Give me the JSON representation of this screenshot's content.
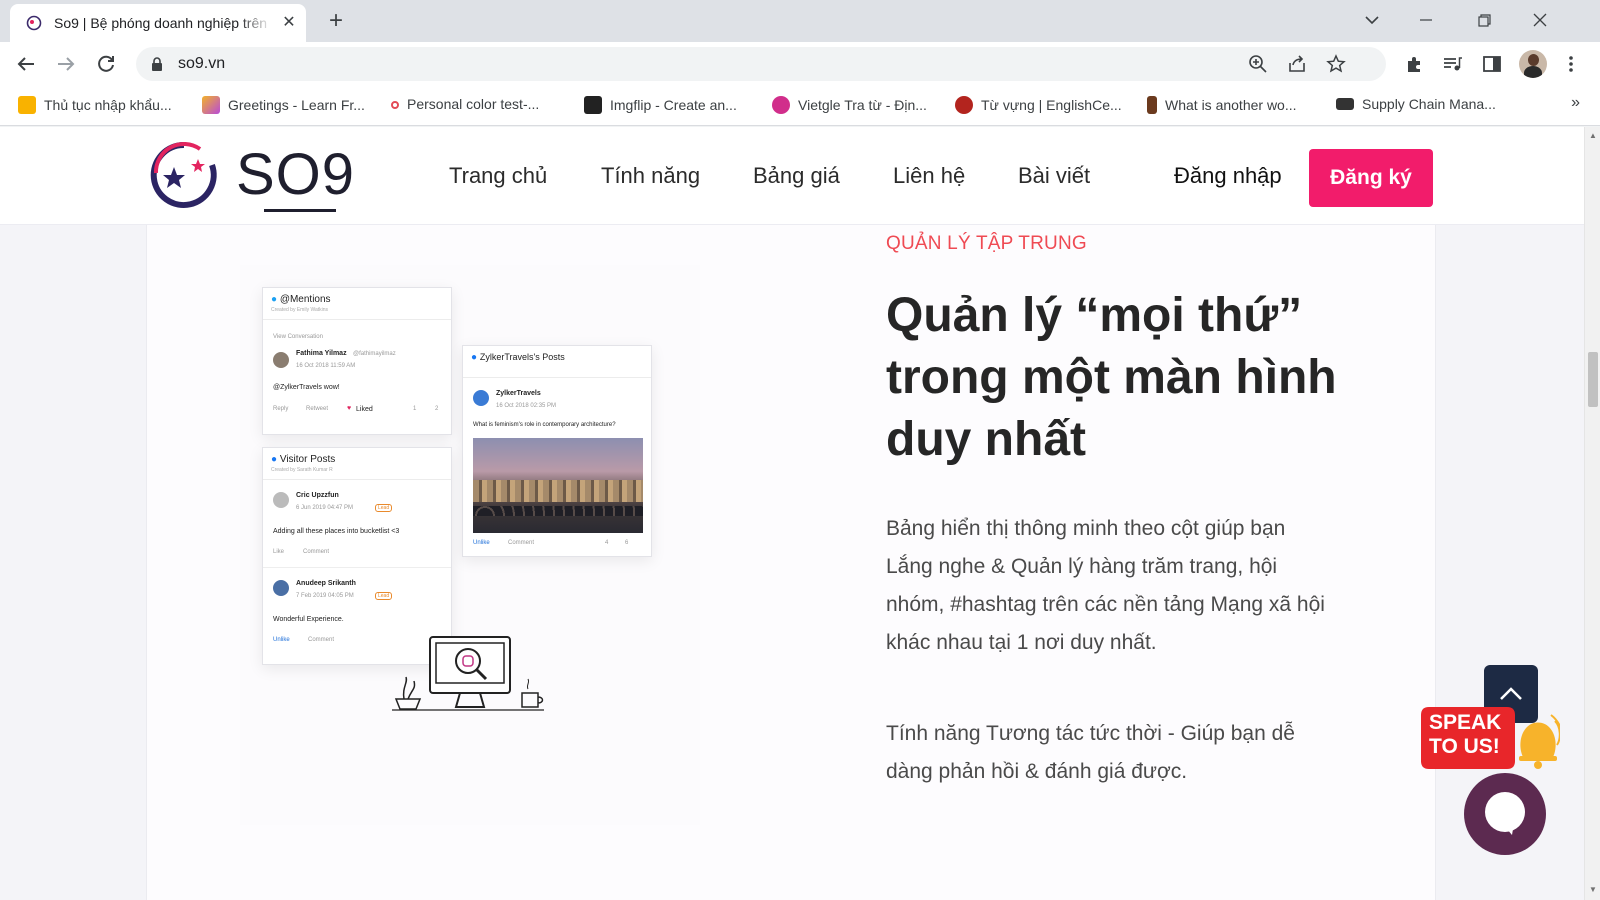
{
  "browser": {
    "tab_title": "So9 | Bệ phóng doanh nghiệp trên",
    "tab_close": "✕",
    "new_tab": "+",
    "url": "so9.vn",
    "bookmarks": [
      {
        "label": "Thủ tục nhập khẩu...",
        "icon": "bookmark-4-icon",
        "color": "#f9b200"
      },
      {
        "label": "Greetings - Learn Fr...",
        "icon": "bookmark-chart-icon",
        "color": "#b84ad8"
      },
      {
        "label": "Personal color test-...",
        "icon": "bookmark-dot-icon",
        "color": "#e34b56"
      },
      {
        "label": "Imgflip - Create an...",
        "icon": "bookmark-imgflip-icon",
        "color": "#222222"
      },
      {
        "label": "Vietgle Tra từ - Địn...",
        "icon": "bookmark-vietgle-icon",
        "color": "#d12e8b"
      },
      {
        "label": "Từ vựng | EnglishCe...",
        "icon": "bookmark-bubble-icon",
        "color": "#b3241e"
      },
      {
        "label": "What is another wo...",
        "icon": "bookmark-h-icon",
        "color": "#6b3a1e"
      },
      {
        "label": "Supply Chain Mana...",
        "icon": "bookmark-edx-icon",
        "color": "#333333"
      }
    ],
    "bookmarks_more": "»"
  },
  "site": {
    "brand": "SO9",
    "nav": [
      {
        "label": "Trang chủ"
      },
      {
        "label": "Tính năng"
      },
      {
        "label": "Bảng giá"
      },
      {
        "label": "Liên hệ"
      },
      {
        "label": "Bài viết"
      }
    ],
    "login": "Đăng nhập",
    "signup": "Đăng ký",
    "accent": "#f21c6b"
  },
  "section": {
    "eyebrow": "QUẢN LÝ TẬP TRUNG",
    "headline": "Quản lý “mọi thứ” trong một màn hình duy nhất",
    "para1": "Bảng hiển thị thông minh theo cột giúp bạn Lắng nghe & Quản lý hàng trăm trang, hội nhóm, #hashtag trên các nền tảng Mạng xã hội khác nhau tại 1 nơi duy nhất.",
    "para2": "Tính năng Tương tác tức thời - Giúp bạn dễ dàng phản hồi & đánh giá được.",
    "eyebrow_color": "#ef4a53"
  },
  "illustration": {
    "mentions": {
      "title": "@Mentions",
      "sub": "Created by Emily Watkins",
      "view": "View Conversation",
      "author": "Fathima Yilmaz",
      "handle": "@fathimayilmaz",
      "date": "16 Oct 2018 11:59 AM",
      "text_tag": "@ZylkerTravels",
      "text_rest": " wow!",
      "reply": "Reply",
      "retweet": "Retweet",
      "liked": "Liked",
      "count1": "1",
      "count2": "2"
    },
    "visitor": {
      "title": "Visitor Posts",
      "sub": "Created by Sarath Kumar R",
      "p1_author": "Cric Upzzfun",
      "p1_date": "6 Jun 2019 04:47 PM",
      "p1_text": "Adding all these places into bucketlist <3",
      "p2_author": "Anudeep Srikanth",
      "p2_date": "7 Feb 2019 04:05 PM",
      "p2_text": "Wonderful Experience.",
      "like": "Like",
      "unlike": "Unlike",
      "comment": "Comment",
      "lead": "Lead"
    },
    "zylker": {
      "title": "ZylkerTravels's Posts",
      "author": "ZylkerTravels",
      "date": "16 Oct 2018 02:35 PM",
      "text": "What is feminism's role in contemporary architecture?",
      "unlike": "Unlike",
      "comment": "Comment",
      "c1": "4",
      "c2": "6"
    }
  },
  "widgets": {
    "speak_line1": "SPEAK",
    "speak_line2": "TO US!"
  }
}
